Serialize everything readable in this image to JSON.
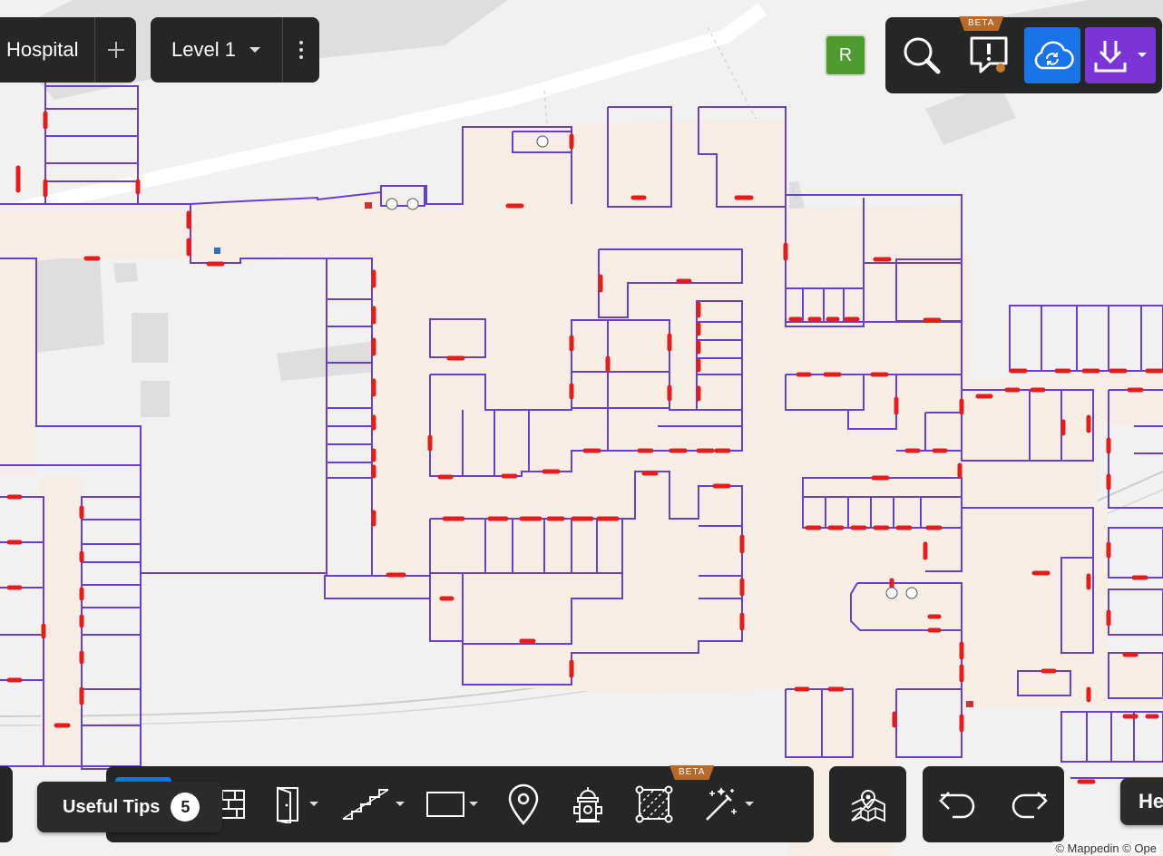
{
  "header": {
    "venue_label": "Hospital",
    "level_label": "Level 1"
  },
  "user": {
    "avatar_initial": "R",
    "avatar_color": "#4f9a2f"
  },
  "top_tools": {
    "beta_label": "BETA",
    "icons": [
      "search-icon",
      "alert-icon",
      "cloud-sync-icon",
      "download-icon"
    ],
    "sync_color": "#1a73e8",
    "download_color": "#7b35d6"
  },
  "toolbar": {
    "beta_label": "BETA",
    "tools": [
      "wall-icon",
      "door-icon",
      "stairs-icon",
      "rectangle-icon",
      "location-pin-icon",
      "hydrant-icon",
      "area-select-icon",
      "magic-wand-icon"
    ],
    "active_color": "#1a73e8"
  },
  "tips": {
    "label": "Useful Tips",
    "count": "5"
  },
  "history": {
    "icons": [
      "undo-icon",
      "redo-icon"
    ]
  },
  "help": {
    "label": "He"
  },
  "attribution": {
    "text": "© Mappedin © Ope"
  },
  "map_colors": {
    "wall": "#6a3fd0",
    "door": "#e51c1c",
    "hall": "#f6eee4",
    "base": "#f1f1f1"
  }
}
